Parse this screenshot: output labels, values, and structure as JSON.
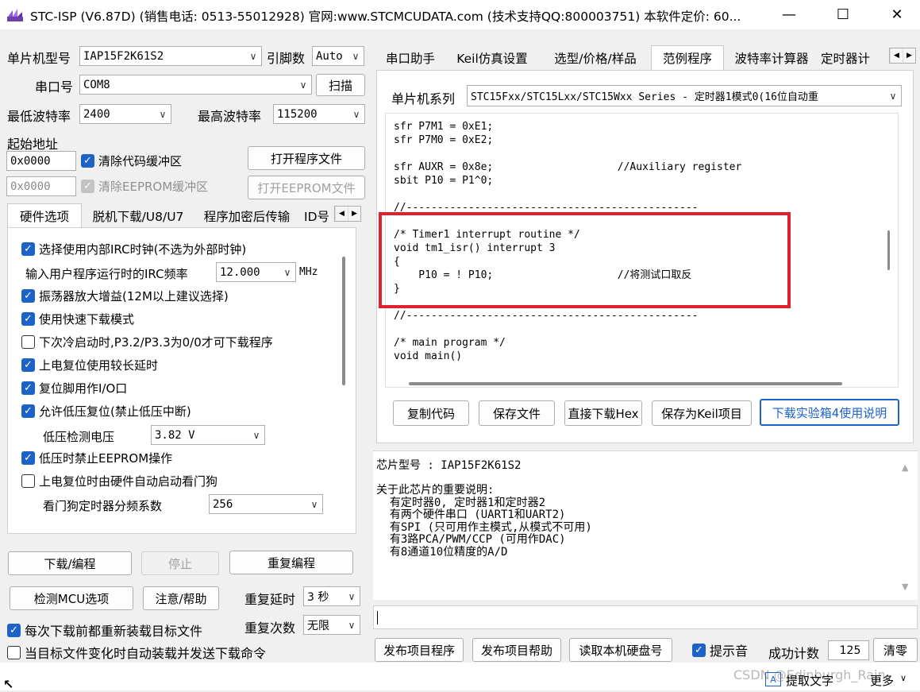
{
  "window": {
    "title": "STC-ISP (V6.87D) (销售电话: 0513-55012928) 官网:www.STCMCUDATA.com (技术支持QQ:800003751) 本软件定价: 60...",
    "minimize": "—",
    "maximize": "☐",
    "close": "✕"
  },
  "left": {
    "mcu_type_label": "单片机型号",
    "mcu_type_value": "IAP15F2K61S2",
    "pin_label": "引脚数",
    "pin_value": "Auto",
    "port_label": "串口号",
    "port_value": "COM8",
    "scan_button": "扫描",
    "min_baud_label": "最低波特率",
    "min_baud_value": "2400",
    "max_baud_label": "最高波特率",
    "max_baud_value": "115200",
    "start_addr_label": "起始地址",
    "code_addr": "0x0000",
    "clear_code_label": "清除代码缓冲区",
    "open_program_button": "打开程序文件",
    "eeprom_addr": "0x0000",
    "clear_eeprom_label": "清除EEPROM缓冲区",
    "open_eeprom_button": "打开EEPROM文件",
    "tabs": [
      "硬件选项",
      "脱机下载/U8/U7",
      "程序加密后传输",
      "ID号"
    ],
    "options": {
      "opt1": "选择使用内部IRC时钟(不选为外部时钟)",
      "irc_label": "输入用户程序运行时的IRC频率",
      "irc_value": "12.000",
      "irc_unit": "MHz",
      "opt2": "振荡器放大增益(12M以上建议选择)",
      "opt3": "使用快速下载模式",
      "opt4": "下次冷启动时,P3.2/P3.3为0/0才可下载程序",
      "opt5": "上电复位使用较长延时",
      "opt6": "复位脚用作I/O口",
      "opt7": "允许低压复位(禁止低压中断)",
      "lv_label": "低压检测电压",
      "lv_value": "3.82 V",
      "opt8": "低压时禁止EEPROM操作",
      "opt9": "上电复位时由硬件自动启动看门狗",
      "wdt_label": "看门狗定时器分频系数",
      "wdt_value": "256"
    },
    "download_button": "下载/编程",
    "stop_button": "停止",
    "reprogram_button": "重复编程",
    "check_mcu_button": "检测MCU选项",
    "help_button": "注意/帮助",
    "retry_delay_label": "重复延时",
    "retry_delay_value": "3 秒",
    "retry_count_label": "重复次数",
    "retry_count_value": "无限",
    "reload_label": "每次下载前都重新装载目标文件",
    "auto_send_label": "当目标文件变化时自动装载并发送下载命令"
  },
  "right": {
    "tabs": [
      "串口助手",
      "Keil仿真设置",
      "选型/价格/样品",
      "范例程序",
      "波特率计算器",
      "定时器计"
    ],
    "series_label": "单片机系列",
    "series_value": "STC15Fxx/STC15Lxx/STC15Wxx Series - 定时器1模式0(16位自动重",
    "code_lines": [
      "sfr P7M1 = 0xE1;",
      "sfr P7M0 = 0xE2;",
      "",
      "sfr AUXR = 0x8e;                    //Auxiliary register",
      "sbit P10 = P1^0;",
      "",
      "//-----------------------------------------------",
      "",
      "/* Timer1 interrupt routine */",
      "void tm1_isr() interrupt 3",
      "{",
      "    P10 = ! P10;                    //将测试口取反",
      "}",
      "",
      "//-----------------------------------------------",
      "",
      "/* main program */",
      "void main()"
    ],
    "copy_code_button": "复制代码",
    "save_file_button": "保存文件",
    "direct_download_button": "直接下载Hex",
    "save_keil_button": "保存为Keil项目",
    "lab_manual_button": "下载实验箱4使用说明",
    "chip_label": "芯片型号 : IAP15F2K61S2",
    "info_lines": [
      "关于此芯片的重要说明:",
      "  有定时器0, 定时器1和定时器2",
      "  有两个硬件串口 (UART1和UART2)",
      "  有SPI (只可用作主模式,从模式不可用)",
      "  有3路PCA/PWM/CCP (可用作DAC)",
      "  有8通道10位精度的A/D"
    ],
    "publish_button": "发布项目程序",
    "publish_help_button": "发布项目帮助",
    "read_disk_button": "读取本机硬盘号",
    "beep_label": "提示音",
    "success_label": "成功计数",
    "success_value": "125",
    "clear_button": "清零"
  },
  "overlay": {
    "extract_text": "提取文字",
    "more": "更多",
    "watermark": "CSDN @Edinburgh_Rain"
  },
  "colors": {
    "accent": "#1d63c7",
    "highlight": "#e0202a"
  }
}
